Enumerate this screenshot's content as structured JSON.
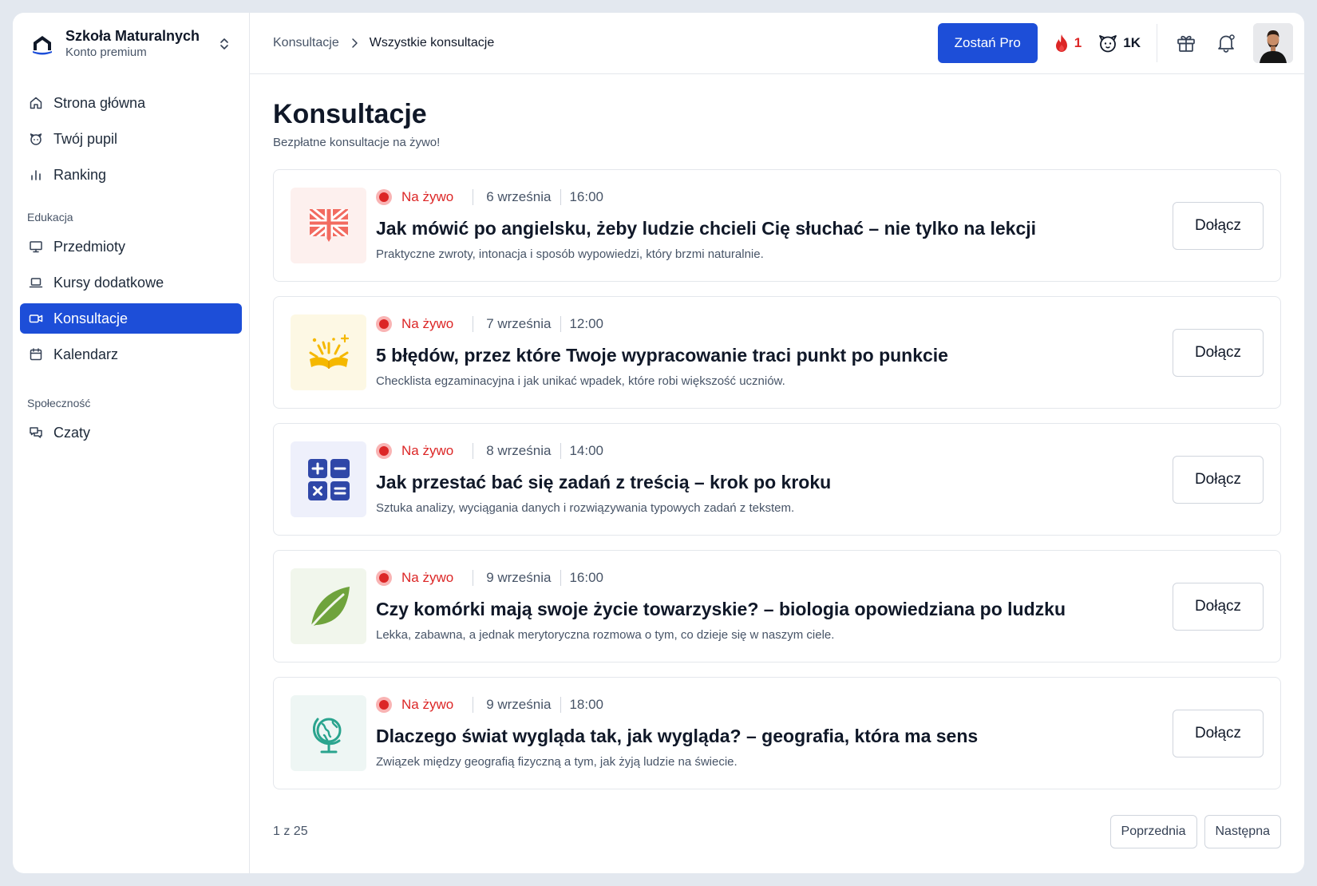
{
  "brand": {
    "name": "Szkoła Maturalnych",
    "plan": "Konto premium"
  },
  "sidebar": {
    "items_top": [
      {
        "label": "Strona główna",
        "icon": "home-icon"
      },
      {
        "label": "Twój pupil",
        "icon": "pet-icon"
      },
      {
        "label": "Ranking",
        "icon": "chart-bar-icon"
      }
    ],
    "sections": [
      {
        "title": "Edukacja",
        "items": [
          {
            "label": "Przedmioty",
            "icon": "presentation-icon"
          },
          {
            "label": "Kursy dodatkowe",
            "icon": "laptop-icon"
          },
          {
            "label": "Konsultacje",
            "icon": "video-icon",
            "active": true
          },
          {
            "label": "Kalendarz",
            "icon": "calendar-icon"
          }
        ]
      },
      {
        "title": "Społeczność",
        "items": [
          {
            "label": "Czaty",
            "icon": "chat-icon"
          }
        ]
      }
    ]
  },
  "topbar": {
    "breadcrumb": {
      "parent": "Konsultacje",
      "current": "Wszystkie konsultacje"
    },
    "pro_label": "Zostań Pro",
    "streak_count": "1",
    "pet_points": "1K"
  },
  "page": {
    "title": "Konsultacje",
    "subtitle": "Bezpłatne konsultacje na żywo!"
  },
  "consultations": [
    {
      "live_label": "Na żywo",
      "date": "6 września",
      "time": "16:00",
      "title": "Jak mówić po angielsku, żeby ludzie chcieli Cię słuchać – nie tylko na lekcji",
      "description": "Praktyczne zwroty, intonacja i sposób wypowiedzi, który brzmi naturalnie.",
      "join_label": "Dołącz",
      "icon": "uk-flag-icon",
      "thumb_color": "#fdf0ee"
    },
    {
      "live_label": "Na żywo",
      "date": "7 września",
      "time": "12:00",
      "title": "5 błędów, przez które Twoje wypracowanie traci punkt po punkcie",
      "description": "Checklista egzaminacyjna i jak unikać wpadek, które robi większość uczniów.",
      "join_label": "Dołącz",
      "icon": "open-book-icon",
      "thumb_color": "#fdf8e4"
    },
    {
      "live_label": "Na żywo",
      "date": "8 września",
      "time": "14:00",
      "title": "Jak przestać bać się zadań z treścią – krok po kroku",
      "description": "Sztuka analizy, wyciągania danych i rozwiązywania typowych zadań z tekstem.",
      "join_label": "Dołącz",
      "icon": "calculator-icon",
      "thumb_color": "#eef0fb"
    },
    {
      "live_label": "Na żywo",
      "date": "9 września",
      "time": "16:00",
      "title": "Czy komórki mają swoje życie towarzyskie? – biologia opowiedziana po ludzku",
      "description": "Lekka, zabawna, a jednak merytoryczna rozmowa o tym, co dzieje się w naszym ciele.",
      "join_label": "Dołącz",
      "icon": "leaf-icon",
      "thumb_color": "#f1f6ec"
    },
    {
      "live_label": "Na żywo",
      "date": "9 września",
      "time": "18:00",
      "title": "Dlaczego świat wygląda tak, jak wygląda? – geografia, która ma sens",
      "description": "Związek między geografią fizyczną a tym, jak żyją ludzie na świecie.",
      "join_label": "Dołącz",
      "icon": "globe-icon",
      "thumb_color": "#eef6f4"
    }
  ],
  "pagination": {
    "info": "1 z 25",
    "prev_label": "Poprzednia",
    "next_label": "Następna"
  },
  "colors": {
    "accent": "#1d4ed8",
    "live": "#dc2626"
  }
}
